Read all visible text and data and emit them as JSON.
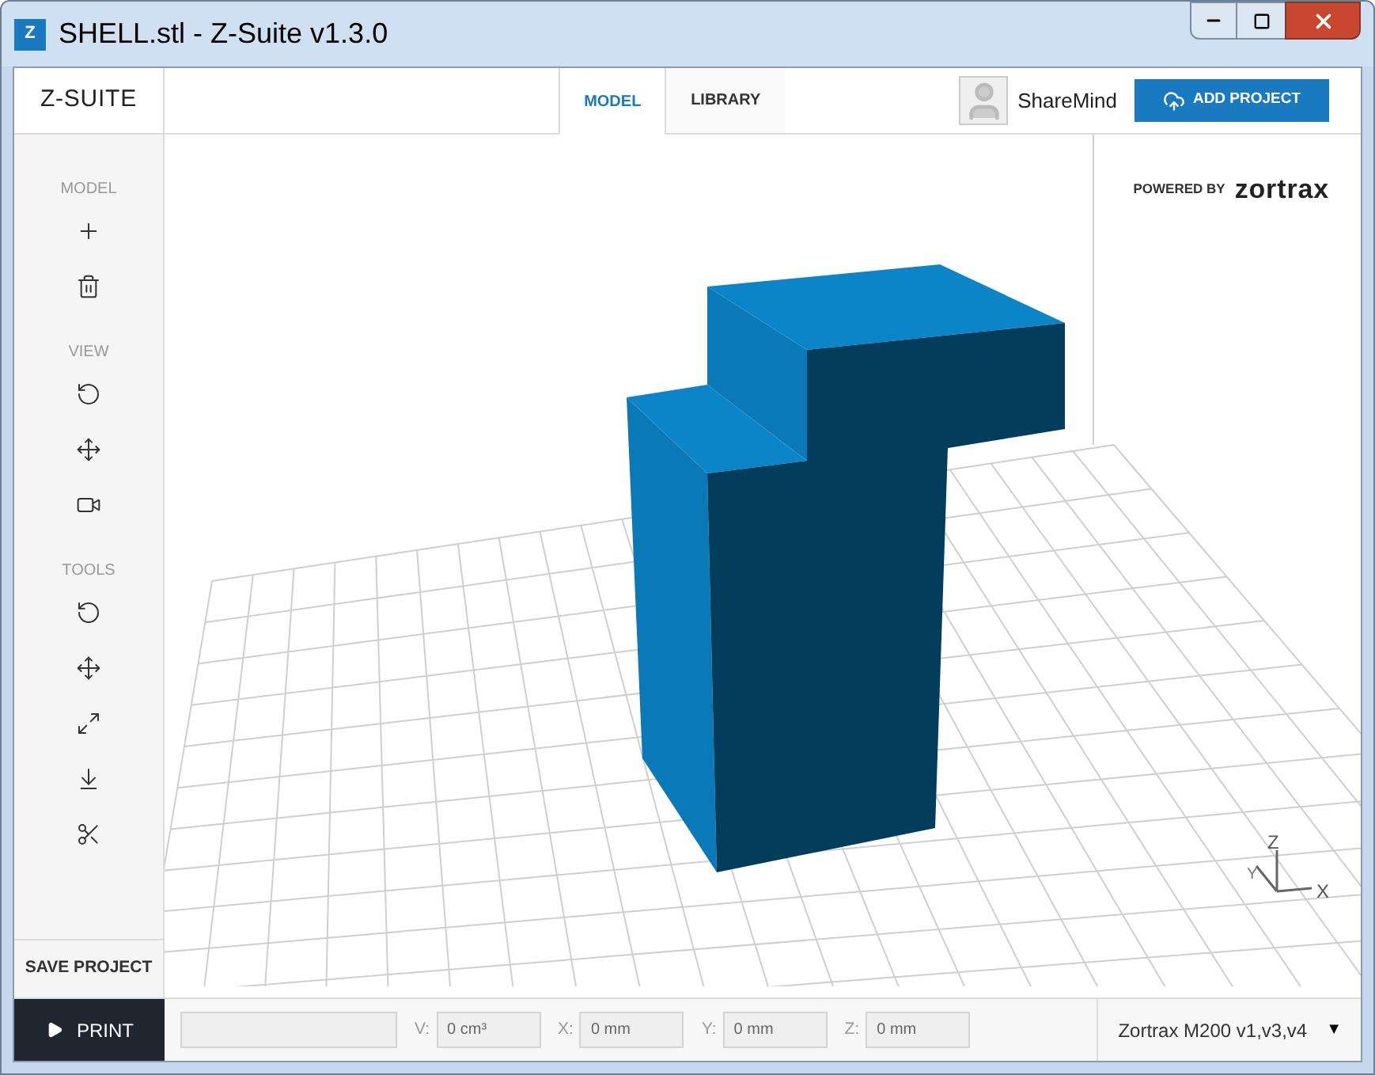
{
  "window": {
    "title": "SHELL.stl - Z-Suite v1.3.0",
    "app_icon_letter": "Z"
  },
  "header": {
    "logo": "Z-SUITE",
    "tabs": [
      {
        "label": "MODEL",
        "selected": true
      },
      {
        "label": "LIBRARY",
        "selected": false
      }
    ],
    "user": "ShareMind",
    "add_button": "ADD PROJECT"
  },
  "sidebar": {
    "sections": [
      {
        "title": "MODEL",
        "tools": [
          {
            "kind": "add"
          },
          {
            "kind": "delete"
          }
        ]
      },
      {
        "title": "VIEW",
        "tools": [
          {
            "kind": "rotate-view"
          },
          {
            "kind": "pan"
          },
          {
            "kind": "camera"
          }
        ]
      },
      {
        "title": "TOOLS",
        "tools": [
          {
            "kind": "rotate"
          },
          {
            "kind": "move"
          },
          {
            "kind": "scale"
          },
          {
            "kind": "lay-flat"
          },
          {
            "kind": "cut"
          }
        ]
      }
    ],
    "save_button": "SAVE PROJECT"
  },
  "viewport": {
    "powered_by": "POWERED BY",
    "brand": "zortrax",
    "axes": [
      "Z",
      "Y",
      "X"
    ]
  },
  "bottom_bar": {
    "print_button": "PRINT",
    "fields": [
      {
        "label": "V:",
        "value": "0 cm³"
      },
      {
        "label": "X:",
        "value": "0 mm"
      },
      {
        "label": "Y:",
        "value": "0 mm"
      },
      {
        "label": "Z:",
        "value": "0 mm"
      }
    ],
    "printer": "Zortrax M200 v1,v3,v4",
    "printer_caret": "▼"
  }
}
